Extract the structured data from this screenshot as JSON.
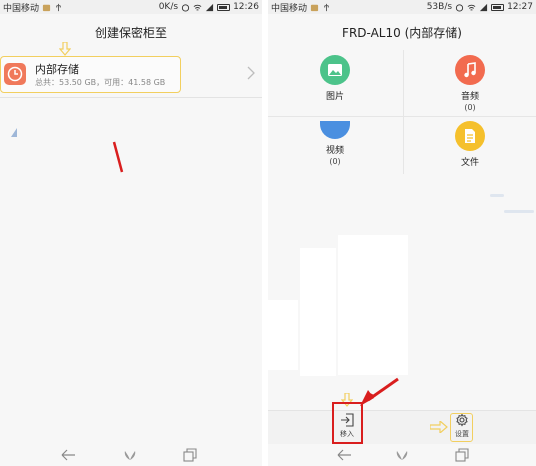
{
  "left_screen": {
    "status": {
      "carrier": "中国移动",
      "speed": "0K/s",
      "time": "12:26"
    },
    "title": "创建保密柜至",
    "storage": {
      "name": "内部存储",
      "detail": "总共：53.50 GB，可用：41.58 GB"
    }
  },
  "right_screen": {
    "status": {
      "carrier": "中国移动",
      "speed": "53B/s",
      "time": "12:27"
    },
    "title": "FRD-AL10 (内部存储)",
    "categories": [
      {
        "label": "图片",
        "count": "",
        "color": "#4cc38a",
        "icon": "image-icon"
      },
      {
        "label": "音频",
        "count": "(0)",
        "color": "#f26b4f",
        "icon": "music-note-icon"
      },
      {
        "label": "视频",
        "count": "(0)",
        "color": "#4a8fe0",
        "icon": "video-icon"
      },
      {
        "label": "文件",
        "count": "",
        "color": "#f5c02c",
        "icon": "document-icon"
      }
    ],
    "toolbar": {
      "move_in_label": "移入",
      "settings_label": "设置"
    }
  },
  "colors": {
    "highlight_red": "#d91e1e",
    "highlight_yellow": "#f2cf5f",
    "storage_icon": "#f0795b"
  }
}
